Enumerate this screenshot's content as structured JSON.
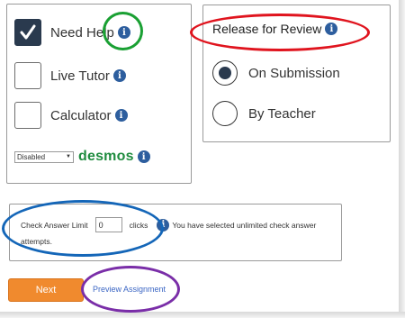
{
  "options": {
    "need_help": {
      "label": "Need Help",
      "checked": true
    },
    "live_tutor": {
      "label": "Live Tutor",
      "checked": false
    },
    "calculator": {
      "label": "Calculator",
      "checked": false
    },
    "calculator_select": {
      "selected": "Disabled"
    },
    "desmos_logo": "desmos"
  },
  "release": {
    "title": "Release for Review",
    "choices": [
      {
        "label": "On Submission",
        "selected": true
      },
      {
        "label": "By Teacher",
        "selected": false
      }
    ]
  },
  "check_answer": {
    "label": "Check Answer Limit",
    "value": "0",
    "unit": "clicks",
    "note_line1": "You have selected unlimited check answer",
    "note_line2": "attempts."
  },
  "actions": {
    "next_label": "Next",
    "preview_label": "Preview Assignment"
  },
  "colors": {
    "annotation_green": "#1aa033",
    "annotation_red": "#e0141e",
    "annotation_blue": "#1466b8",
    "annotation_purple": "#7a2ea8",
    "accent_orange": "#f08a2e",
    "info_blue": "#2d5e9e"
  },
  "icons": {
    "info": "info-icon",
    "check": "checkmark-icon"
  }
}
